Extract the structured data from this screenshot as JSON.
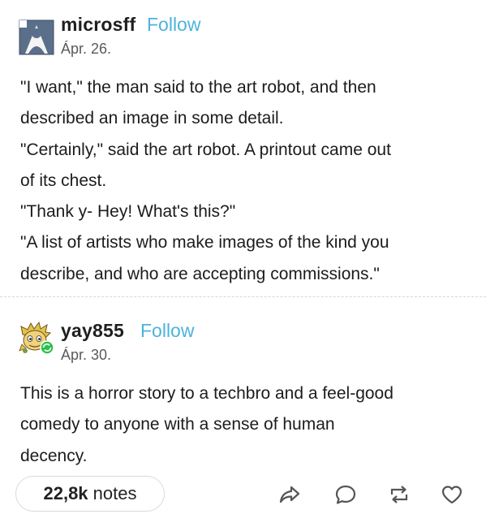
{
  "posts": [
    {
      "username": "microsff",
      "follow_label": "Follow",
      "date": "Ápr. 26.",
      "avatar_icon": "user-silhouette-icon",
      "lines": [
        "\"I want,\" the man said to the art robot, and then",
        "described an image in some detail.",
        "\"Certainly,\" said the art robot. A printout came out",
        "of its chest.",
        "\"Thank y- Hey! What's this?\"",
        "\"A list of artists who make images of the kind you",
        "describe, and who are accepting commissions.\""
      ]
    },
    {
      "username": "yay855",
      "follow_label": "Follow",
      "date": "Ápr. 30.",
      "avatar_icon": "cartoon-avatar-icon",
      "lines": [
        "This is a horror story to a techbro and a feel-good",
        "comedy to anyone with a sense of human",
        "decency."
      ]
    }
  ],
  "footer": {
    "notes_count": "22,8k",
    "notes_label": "notes",
    "actions": [
      "share-icon",
      "reply-icon",
      "reblog-icon",
      "like-icon"
    ]
  },
  "colors": {
    "follow": "#4bb4dd",
    "text": "#1c1c1c",
    "muted": "#5a5a5a",
    "icon": "#555555",
    "avatar1_bg": "#5a6f8a",
    "badge": "#2fbf4a"
  }
}
